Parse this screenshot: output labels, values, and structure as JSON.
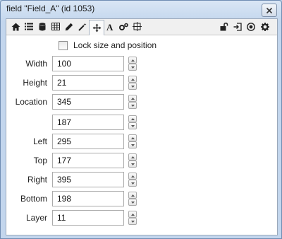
{
  "window": {
    "title": "field \"Field_A\" (id 1053)"
  },
  "toolbar": {
    "left_icons": [
      "house-icon",
      "list-icon",
      "database-icon",
      "table-icon",
      "pencil-icon",
      "magic-wand-icon",
      "move-icon",
      "text-icon",
      "gears-icon",
      "grid-icon"
    ],
    "right_icons": [
      "unlock-icon",
      "import-icon",
      "target-icon",
      "gear-icon"
    ],
    "active_tab": "move-icon"
  },
  "lock": {
    "label": "Lock size and position",
    "checked": false
  },
  "fields": {
    "width": {
      "label": "Width",
      "value": "100"
    },
    "height": {
      "label": "Height",
      "value": "21"
    },
    "location_x": {
      "label": "Location",
      "value": "345"
    },
    "location_y": {
      "label": "",
      "value": "187"
    },
    "left": {
      "label": "Left",
      "value": "295"
    },
    "top": {
      "label": "Top",
      "value": "177"
    },
    "right": {
      "label": "Right",
      "value": "395"
    },
    "bottom": {
      "label": "Bottom",
      "value": "198"
    },
    "layer": {
      "label": "Layer",
      "value": "11"
    }
  }
}
